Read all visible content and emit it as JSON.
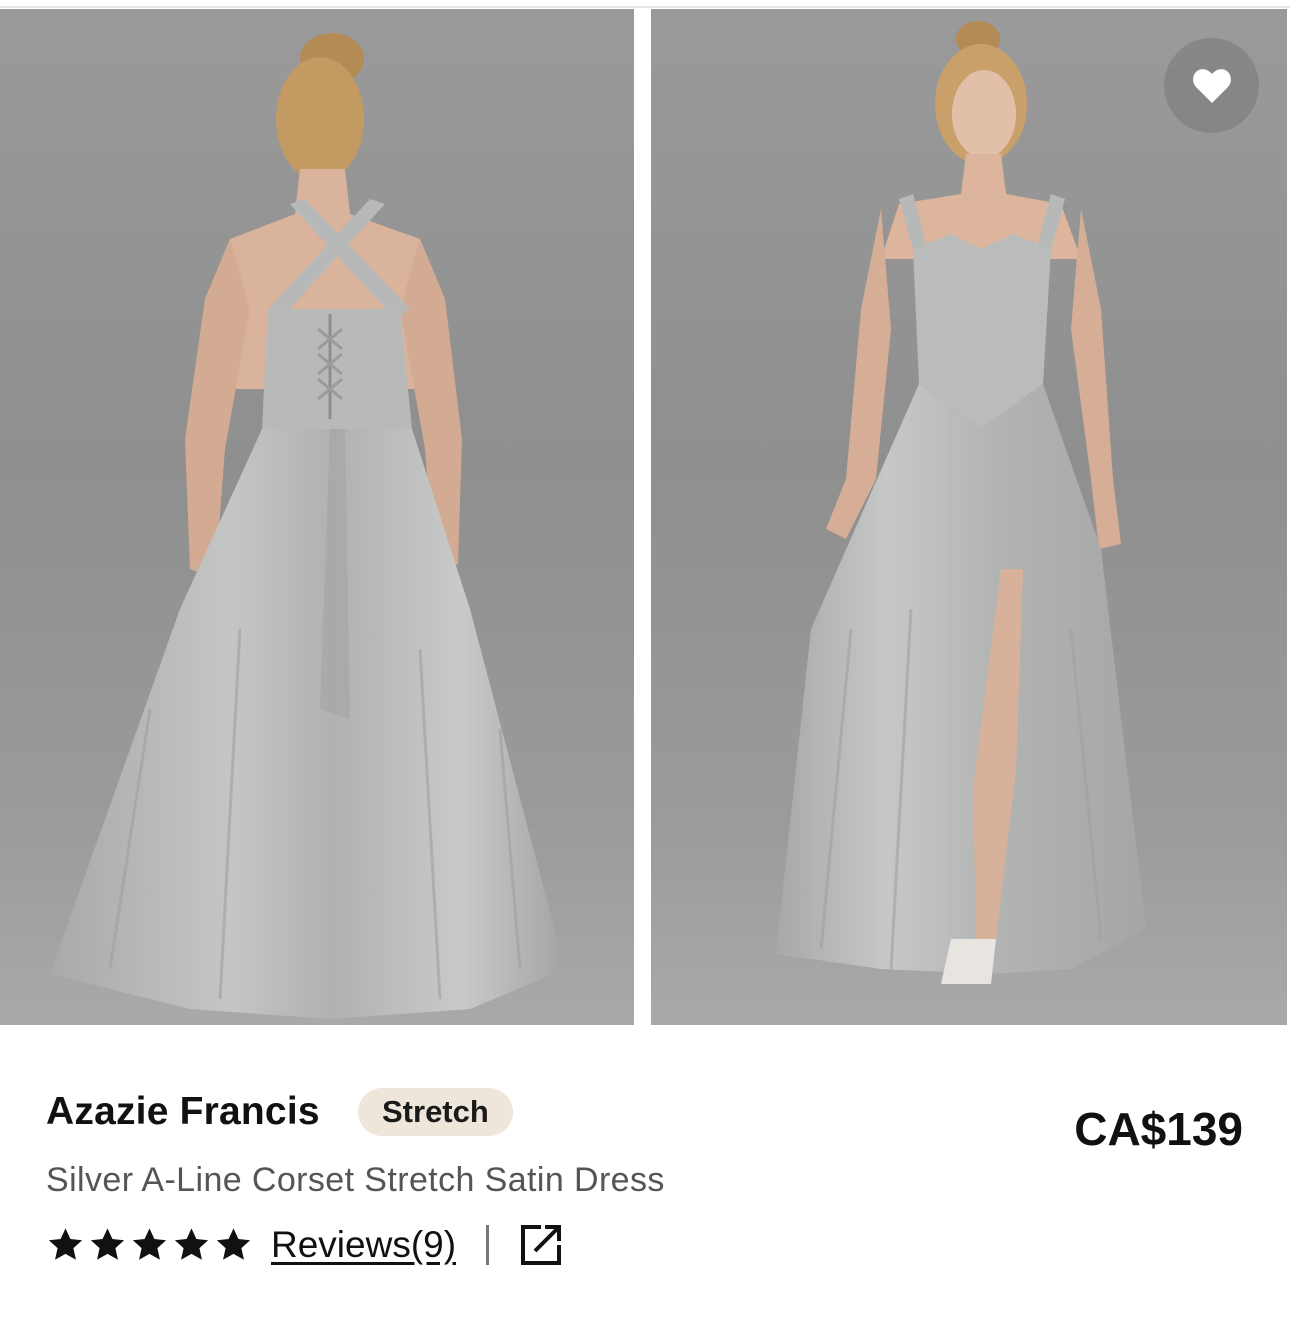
{
  "product": {
    "brand": "Azazie Francis",
    "badge": "Stretch",
    "subtitle": "Silver A-Line Corset Stretch Satin Dress",
    "price": "CA$139",
    "rating_stars": 5,
    "reviews_label": "Reviews(9)"
  },
  "images": [
    {
      "view": "back",
      "description": "model in silver satin dress, back view"
    },
    {
      "view": "front",
      "description": "model in silver satin dress, front view"
    }
  ],
  "icons": {
    "favorite": "heart-icon",
    "star": "star-icon",
    "share": "external-link-icon"
  },
  "colors": {
    "badge_bg": "#efe6db",
    "subtitle": "#555555",
    "dress": "#b6b8b8",
    "backdrop": "#969696"
  }
}
